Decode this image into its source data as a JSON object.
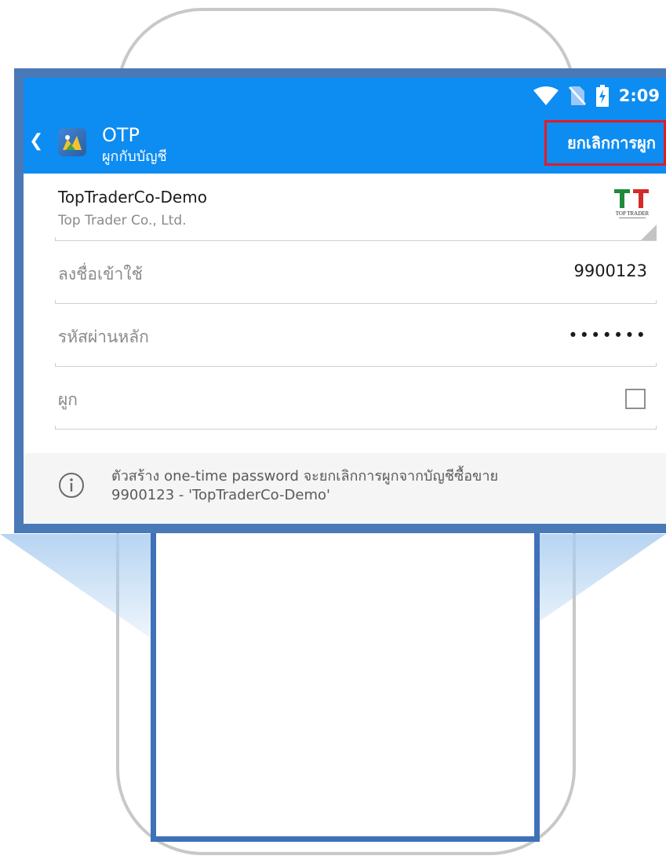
{
  "status_bar": {
    "time": "2:09"
  },
  "app_bar": {
    "title": "OTP",
    "subtitle": "ผูกกับบัญชี",
    "unbind_button": "ยกเลิกการผูก"
  },
  "server": {
    "name": "TopTraderCo-Demo",
    "company": "Top Trader Co., Ltd.",
    "logo_text": "TOP TRADER"
  },
  "fields": {
    "login_label": "ลงชื่อเข้าใช้",
    "login_value": "9900123",
    "password_label": "รหัสผ่านหลัก",
    "password_value": "•••••••",
    "bind_label": "ผูก",
    "bind_checked": false
  },
  "info": {
    "text_line1": "ตัวสร้าง one-time password จะยกเลิกการผูกจากบัญชีซื้อขาย",
    "text_line2": "9900123 - 'TopTraderCo-Demo'"
  },
  "colors": {
    "app_bar": "#0d8cf2",
    "highlight": "#e31b23",
    "frame": "#4a79b8"
  },
  "icons": [
    "wifi-icon",
    "no-sim-icon",
    "battery-charging-icon",
    "back-chevron-icon",
    "metatrader-logo-icon",
    "top-trader-logo",
    "info-icon"
  ]
}
